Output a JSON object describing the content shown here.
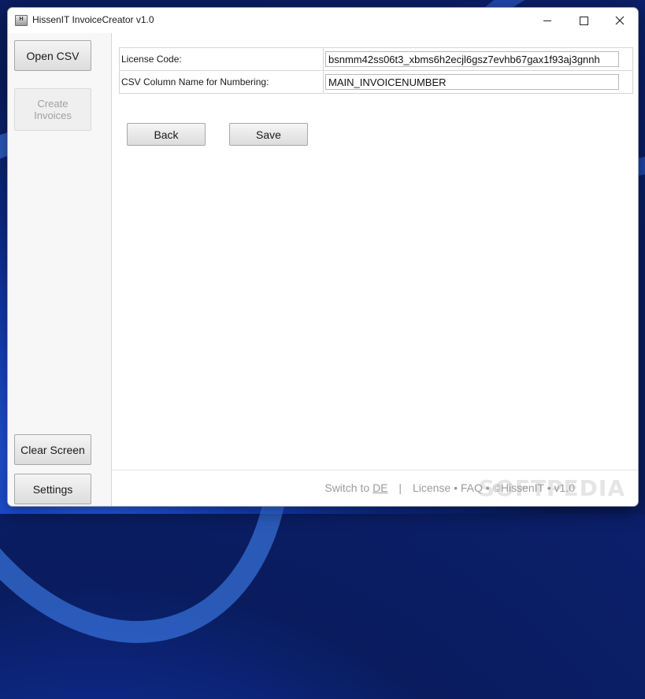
{
  "window": {
    "title": "HissenIT InvoiceCreator v1.0"
  },
  "sidebar": {
    "open_csv": "Open CSV",
    "create_invoices": "Create\nInvoices",
    "clear_screen": "Clear Screen",
    "settings": "Settings"
  },
  "form": {
    "license_label": "License Code:",
    "license_value": "bsnmm42ss06t3_xbms6h2ecjl6gsz7evhb67gax1f93aj3gnnh",
    "column_label": "CSV Column Name for Numbering:",
    "column_value": "MAIN_INVOICENUMBER"
  },
  "actions": {
    "back": "Back",
    "save": "Save"
  },
  "footer": {
    "switch_prefix": "Switch to",
    "switch_lang": "DE",
    "separator": "|",
    "links": "License • FAQ • ©HissenIT • v1.0"
  },
  "watermark": "SOFTPEDIA"
}
